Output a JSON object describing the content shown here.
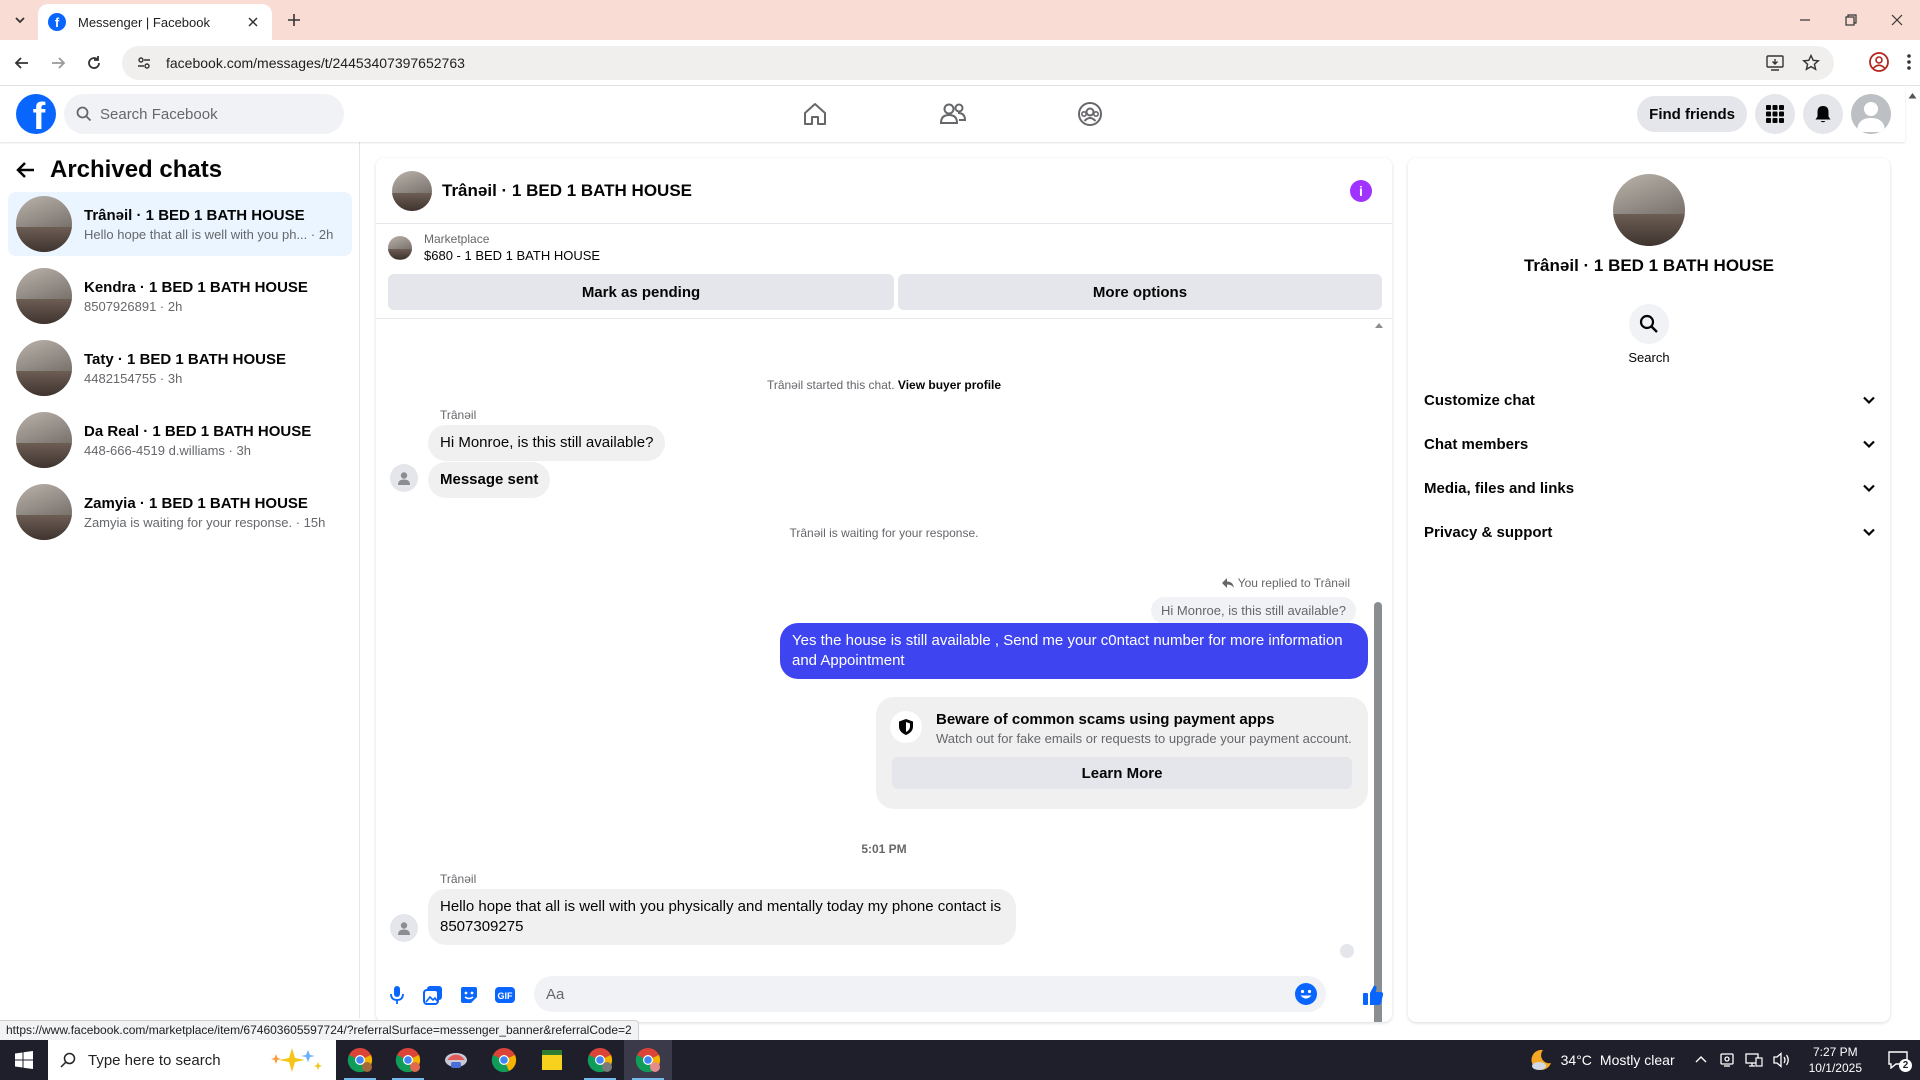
{
  "browser": {
    "tab_title": "Messenger | Facebook",
    "url": "facebook.com/messages/t/24453407397652763",
    "status_url": "https://www.facebook.com/marketplace/item/674603605597724/?referralSurface=messenger_banner&referralCode=2"
  },
  "fb_header": {
    "search_placeholder": "Search Facebook",
    "find_friends_label": "Find friends",
    "brand_color": "#0866ff"
  },
  "sidebar": {
    "title": "Archived chats",
    "chats": [
      {
        "name": "Trânəil · 1 BED 1 BATH HOUSE",
        "preview": "Hello hope that all is well with you ph... · 2h",
        "active": true
      },
      {
        "name": "Kendra · 1 BED 1 BATH HOUSE",
        "preview": "8507926891 · 2h",
        "active": false
      },
      {
        "name": "Taty · 1 BED 1 BATH HOUSE",
        "preview": "4482154755 · 3h",
        "active": false
      },
      {
        "name": "Da Real · 1 BED 1 BATH HOUSE",
        "preview": "448-666-4519 d.williams · 3h",
        "active": false
      },
      {
        "name": "Zamyia · 1 BED 1 BATH HOUSE",
        "preview": "Zamyia is waiting for your response. · 15h",
        "active": false
      }
    ]
  },
  "chat": {
    "title": "Trânəil · 1 BED 1 BATH HOUSE",
    "marketplace_label": "Marketplace",
    "listing": "$680 - 1 BED 1 BATH HOUSE",
    "mark_pending_label": "Mark as pending",
    "more_options_label": "More options",
    "started_text": "Trânəil started this chat.",
    "view_buyer_label": "View buyer profile",
    "sender": "Trânəil",
    "msg1": "Hi Monroe, is this still available?",
    "msg2": "Message sent",
    "waiting_text": "Trânəil is waiting for your response.",
    "reply_label": "You replied to Trânəil",
    "quoted": "Hi Monroe, is this still available?",
    "outgoing": "Yes the house is still available , Send me your c0ntact number for more information and Appointment",
    "scam_title": "Beware of common scams using payment apps",
    "scam_sub": "Watch out for fake emails or requests to upgrade your payment account.",
    "learn_more_label": "Learn More",
    "timestamp": "5:01 PM",
    "msg3": "Hello hope that all is well with you physically and mentally today my phone contact is 8507309275",
    "composer_placeholder": "Aa",
    "gif_label": "GIF",
    "outgoing_color": "#3e45f0",
    "accent_color": "#0866ff"
  },
  "info": {
    "name": "Trânəil · 1 BED 1 BATH HOUSE",
    "search_label": "Search",
    "sections": [
      "Customize chat",
      "Chat members",
      "Media, files and links",
      "Privacy & support"
    ]
  },
  "taskbar": {
    "search_placeholder": "Type here to search",
    "temperature": "34°C",
    "weather": "Mostly clear",
    "time": "7:27 PM",
    "date": "10/1/2025",
    "notification_count": "2"
  }
}
